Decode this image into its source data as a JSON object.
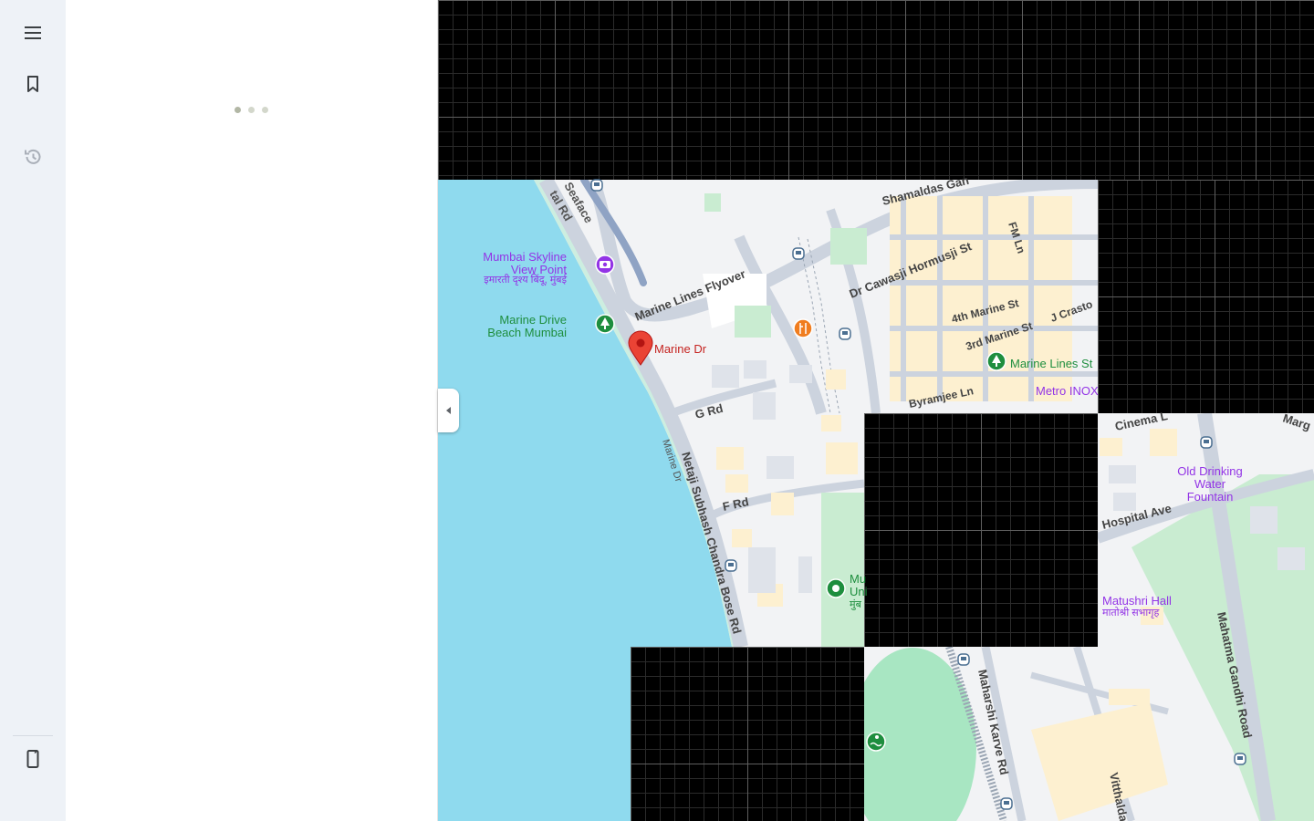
{
  "colors": {
    "water": "#8fdaee",
    "land": "#f2f3f5",
    "road": "#ccd3de",
    "block": "#fdf0d0",
    "park": "#c9ecd1",
    "pin": "#ea4335",
    "poi_purple": "#9334e6",
    "poi_green": "#1e8e3e",
    "poi_food": "#f07d1f",
    "transit": "#4b6f91",
    "loading_dots": [
      "#b2b7a5",
      "#d3d7cb",
      "#d3d7cb"
    ]
  },
  "sidebar": {
    "menu_icon": "menu-icon",
    "saved_icon": "bookmark-icon",
    "recent_icon": "history-icon",
    "app_icon": "phone-icon"
  },
  "pin": {
    "label": "Marine Dr"
  },
  "places": {
    "skyline_en_1": "Mumbai Skyline",
    "skyline_en_2": "View Point",
    "skyline_hi": "इमारती दृश्य बिंदू, मुंबई",
    "beach_1": "Marine Drive",
    "beach_2": "Beach Mumbai",
    "marine_lines_station": "Marine Lines St",
    "metro_inox": "Metro INOX",
    "fountain_1": "Old Drinking",
    "fountain_2": "Water",
    "fountain_3": "Fountain",
    "matushri": "Matushri Hall",
    "matushri_hi": "मातोश्री सभागृह",
    "uni_1": "Mu",
    "uni_2": "Uni",
    "uni_3": "मुंब"
  },
  "roads": {
    "seaface": "Seaface",
    "tal_rd": "tal Rd",
    "flyover": "Marine Lines Flyover",
    "shamaldas": "Shamaldas Gan",
    "cawasji": "Dr Cawasji Hormusji St",
    "fm_ln": "FM Ln",
    "fourth_marine": "4th Marine St",
    "third_marine": "3rd Marine St",
    "j_crasto": "J Crasto",
    "byramjee": "Byramjee Ln",
    "g_rd": "G Rd",
    "f_rd": "F Rd",
    "netaji": "Netaji Subhash Chandra Bose Rd",
    "marine_dr_road": "Marine Dr",
    "cinema": "Cinema L",
    "marg": "Marg",
    "hospital": "Hospital Ave",
    "mg_road": "Mahatma Gandhi Road",
    "maharshi": "Maharshi Karve Rd",
    "vitthal": "Vitthalda"
  }
}
